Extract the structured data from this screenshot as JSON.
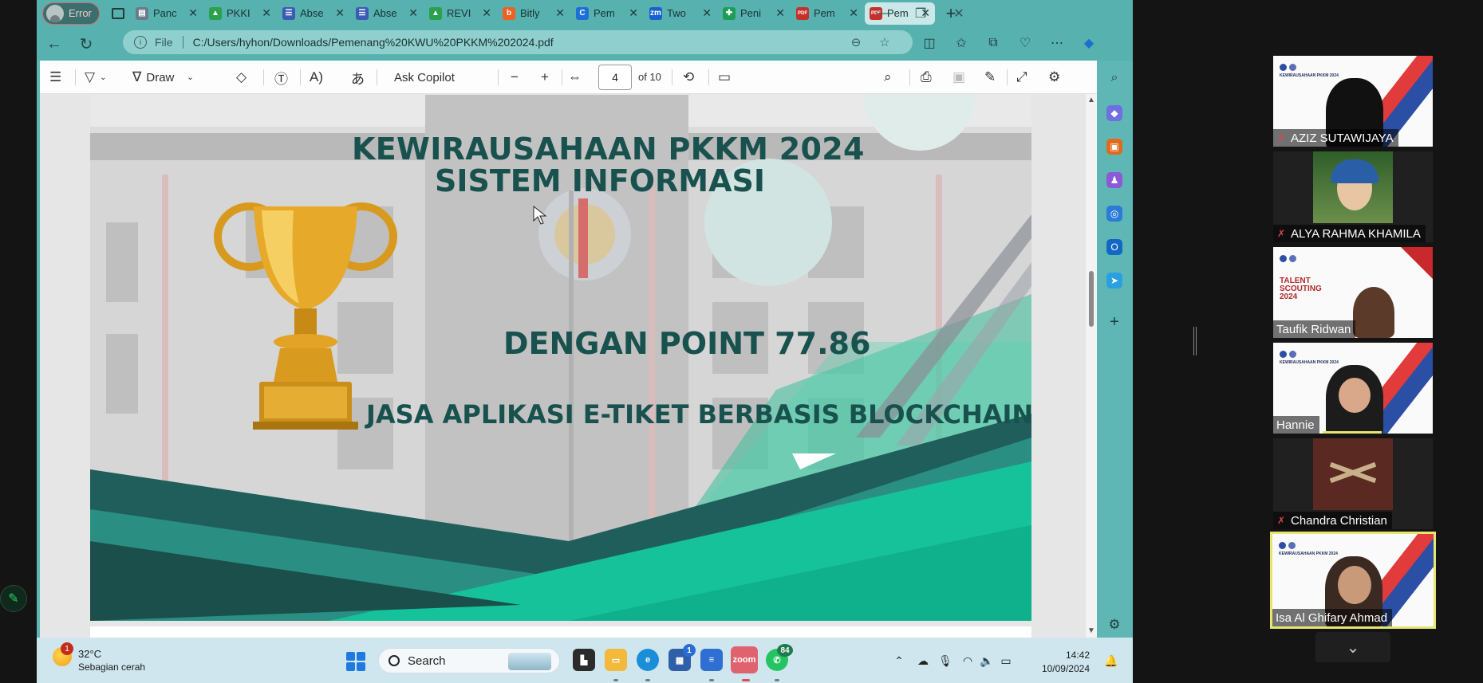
{
  "browser": {
    "profile_label": "Error",
    "tabs": [
      {
        "label": "Panc",
        "favicon_color": "#6c7b8a",
        "favicon": "▤"
      },
      {
        "label": "PKKI",
        "favicon_color": "#2aa14a",
        "favicon": "▲"
      },
      {
        "label": "Abse",
        "favicon_color": "#3b5bb5",
        "favicon": "☰"
      },
      {
        "label": "Abse",
        "favicon_color": "#3b5bb5",
        "favicon": "☰"
      },
      {
        "label": "REVI",
        "favicon_color": "#2aa14a",
        "favicon": "▲"
      },
      {
        "label": "Bitly",
        "favicon_color": "#ee6123",
        "favicon": "b"
      },
      {
        "label": "Pem",
        "favicon_color": "#1d6fd8",
        "favicon": "C"
      },
      {
        "label": "Two",
        "favicon_color": "#1a5fd0",
        "favicon": "zm"
      },
      {
        "label": "Peni",
        "favicon_color": "#1e9e54",
        "favicon": "✚"
      },
      {
        "label": "Pem",
        "favicon_color": "#c6302a",
        "favicon": "PDF"
      },
      {
        "label": "Pem",
        "favicon_color": "#c6302a",
        "favicon": "PDF"
      }
    ],
    "address": {
      "scheme_label": "File",
      "url": "C:/Users/hyhon/Downloads/Pemenang%20KWU%20PKKM%202024.pdf"
    }
  },
  "pdf_toolbar": {
    "draw_label": "Draw",
    "copilot_label": "Ask Copilot",
    "page_number": "4",
    "page_total": "of 10"
  },
  "slide": {
    "title_line1": "KEWIRAUSAHAAN PKKM 2024",
    "title_line2": "SISTEM INFORMASI",
    "point_text": "DENGAN POINT 77.86",
    "project_text": "JASA APLIKASI E-TIKET BERBASIS BLOCKCHAIN"
  },
  "taskbar": {
    "weather_temp": "32°C",
    "weather_desc": "Sebagian cerah",
    "weather_badge": "1",
    "search_placeholder": "Search",
    "store_badge": "1",
    "whatsapp_badge": "84",
    "time": "14:42",
    "date": "10/09/2024"
  },
  "zoom": {
    "participants": [
      {
        "name": "AZIZ SUTAWIJAYA",
        "muted": true,
        "video": "slide"
      },
      {
        "name": "ALYA RAHMA KHAMILA",
        "muted": true,
        "video": "photo"
      },
      {
        "name": "Taufik Ridwan",
        "muted": false,
        "video": "talent"
      },
      {
        "name": "Hannie",
        "muted": false,
        "video": "slide"
      },
      {
        "name": "Chandra Christian",
        "muted": true,
        "video": "book"
      },
      {
        "name": "Isa Al Ghifary Ahmad",
        "muted": false,
        "video": "slide",
        "active": true
      }
    ],
    "talent_slide_title": "TALENT SCOUTING 2024",
    "thumb_slide_title": "KEWIRAUSAHAAN PKKM 2024"
  }
}
